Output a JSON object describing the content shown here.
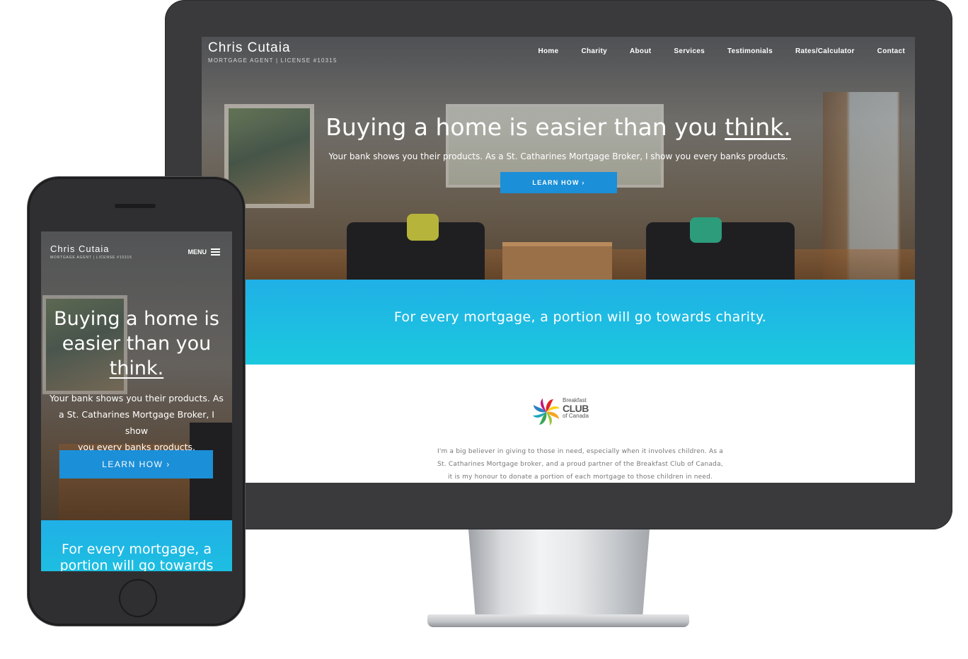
{
  "desktop": {
    "brand": {
      "name": "Chris Cutaia",
      "tagline": "MORTGAGE AGENT | LICENSE #10315"
    },
    "nav": [
      {
        "label": "Home"
      },
      {
        "label": "Charity"
      },
      {
        "label": "About"
      },
      {
        "label": "Services"
      },
      {
        "label": "Testimonials"
      },
      {
        "label": "Rates/Calculator"
      },
      {
        "label": "Contact"
      }
    ],
    "hero": {
      "headline_start": "Buying a home is easier than you ",
      "headline_emphasis": "think.",
      "subline": "Your bank shows you their products. As a St. Catharines Mortgage Broker, I show you every banks products.",
      "cta": "LEARN HOW ›"
    },
    "charity_band": {
      "text": "For every mortgage, a portion will go towards charity."
    },
    "partner": {
      "logo_line1": "Breakfast",
      "logo_line2": "CLUB",
      "logo_line3": "of Canada",
      "paragraph_lines": [
        "I'm a big believer in giving to those in need, especially when it involves children. As a",
        "St. Catharines Mortgage broker, and a proud partner of the Breakfast Club of Canada,",
        "it is my honour to donate a portion of each mortgage to those children in need."
      ]
    }
  },
  "mobile": {
    "brand": {
      "name": "Chris Cutaia",
      "tagline": "MORTGAGE AGENT | LICENSE #10315"
    },
    "menu_label": "MENU",
    "hero": {
      "headline_line1": "Buying a home is",
      "headline_line2": "easier than you",
      "headline_emphasis": "think.",
      "subline_lines": [
        "Your bank shows you their products. As",
        "a St. Catharines Mortgage Broker, I show",
        "you every banks products."
      ],
      "cta": "LEARN HOW ›"
    },
    "charity_band": {
      "line1": "For every mortgage, a",
      "line2": "portion will go towards"
    }
  },
  "colors": {
    "accent_blue": "#1b8fd8",
    "band_top": "#20b0e6",
    "band_bottom": "#1bc8de",
    "device_body": "#3a3a3c"
  },
  "icons": {
    "menu": "hamburger-icon",
    "partner_logo": "breakfast-club-pinwheel-logo"
  }
}
